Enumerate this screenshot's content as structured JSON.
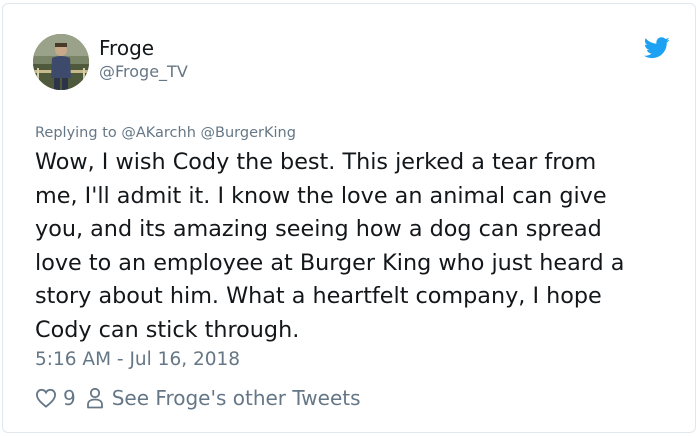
{
  "user": {
    "display_name": "Froge",
    "handle": "@Froge_TV"
  },
  "reply": {
    "prefix": "Replying to ",
    "mentions": [
      "@AKarchh",
      "@BurgerKing"
    ]
  },
  "tweet": {
    "lines": [
      "Wow, I wish Cody the best. This jerked a tear from",
      "me, I'll admit it. I know the love an animal can give",
      "you, and its amazing seeing how a dog can spread",
      "love to an employee at Burger King who just heard a",
      "story about him. What a heartfelt company, I hope",
      "Cody can stick through."
    ],
    "timestamp": "5:16 AM - Jul 16, 2018"
  },
  "actions": {
    "like_count": "9",
    "other_tweets_label": "See Froge's other Tweets"
  },
  "icons": {
    "brand": "twitter-bird-icon",
    "like": "heart-icon",
    "profile": "person-icon"
  },
  "colors": {
    "twitter_blue": "#1da1f2",
    "text_primary": "#14171a",
    "text_secondary": "#657786",
    "border": "#e1e8ed"
  }
}
